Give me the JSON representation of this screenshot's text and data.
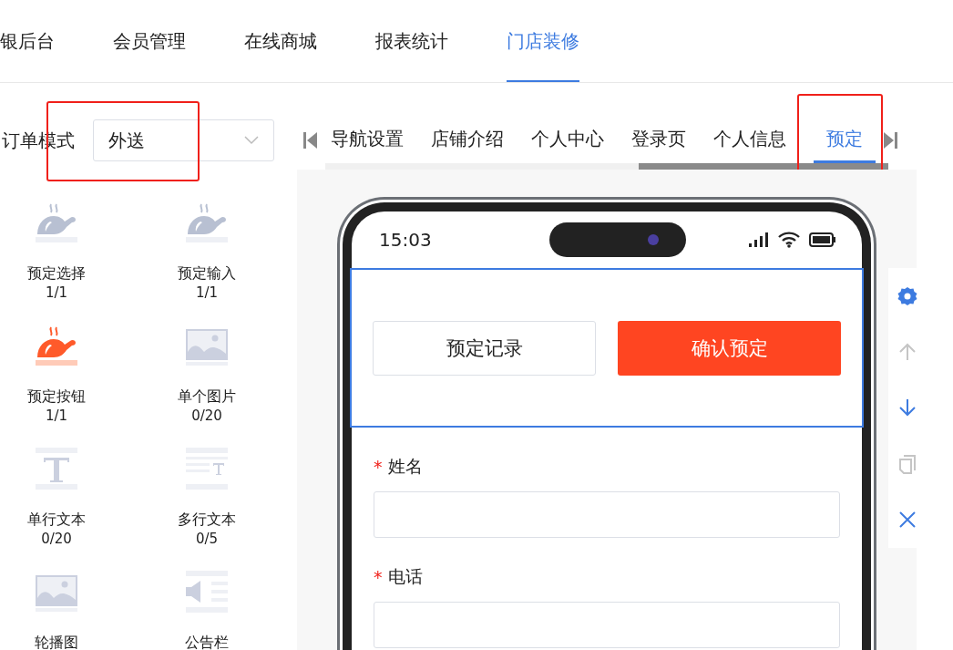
{
  "nav_tabs": [
    {
      "label": "银后台",
      "selected": false
    },
    {
      "label": "会员管理",
      "selected": false
    },
    {
      "label": "在线商城",
      "selected": false
    },
    {
      "label": "报表统计",
      "selected": false
    },
    {
      "label": "门店装修",
      "selected": true
    }
  ],
  "order_mode": {
    "label": "订单模式",
    "value": "外送",
    "marked": true
  },
  "components": [
    {
      "name": "预定选择",
      "count": "1/1",
      "kind": "chicken",
      "highlighted": false
    },
    {
      "name": "预定输入",
      "count": "1/1",
      "kind": "chicken",
      "highlighted": false
    },
    {
      "name": "预定按钮",
      "count": "1/1",
      "kind": "chicken",
      "highlighted": true
    },
    {
      "name": "单个图片",
      "count": "0/20",
      "kind": "image",
      "highlighted": false
    },
    {
      "name": "单行文本",
      "count": "0/20",
      "kind": "text",
      "highlighted": false
    },
    {
      "name": "多行文本",
      "count": "0/5",
      "kind": "multitext",
      "highlighted": false
    },
    {
      "name": "轮播图",
      "kind": "carousel",
      "highlighted": false
    },
    {
      "name": "公告栏",
      "kind": "notice",
      "highlighted": false
    }
  ],
  "page_tabs": [
    {
      "label": "导航设置",
      "selected": false,
      "marked": false
    },
    {
      "label": "店铺介绍",
      "selected": false,
      "marked": false
    },
    {
      "label": "个人中心",
      "selected": false,
      "marked": false
    },
    {
      "label": "登录页",
      "selected": false,
      "marked": false
    },
    {
      "label": "个人信息",
      "selected": false,
      "marked": false
    },
    {
      "label": "预定",
      "selected": true,
      "marked": true
    }
  ],
  "phone": {
    "time": "15:03",
    "buttons": [
      {
        "label": "预定记录",
        "kind": "outline"
      },
      {
        "label": "确认预定",
        "kind": "primary"
      }
    ],
    "fields": [
      {
        "label": "姓名",
        "required_mark": "*"
      },
      {
        "label": "电话",
        "required_mark": "*"
      }
    ]
  },
  "toolbar": [
    {
      "kind": "settings",
      "disabled": false
    },
    {
      "kind": "up",
      "disabled": true
    },
    {
      "kind": "down",
      "disabled": false
    },
    {
      "kind": "copy",
      "disabled": true
    },
    {
      "kind": "delete",
      "disabled": false
    }
  ]
}
